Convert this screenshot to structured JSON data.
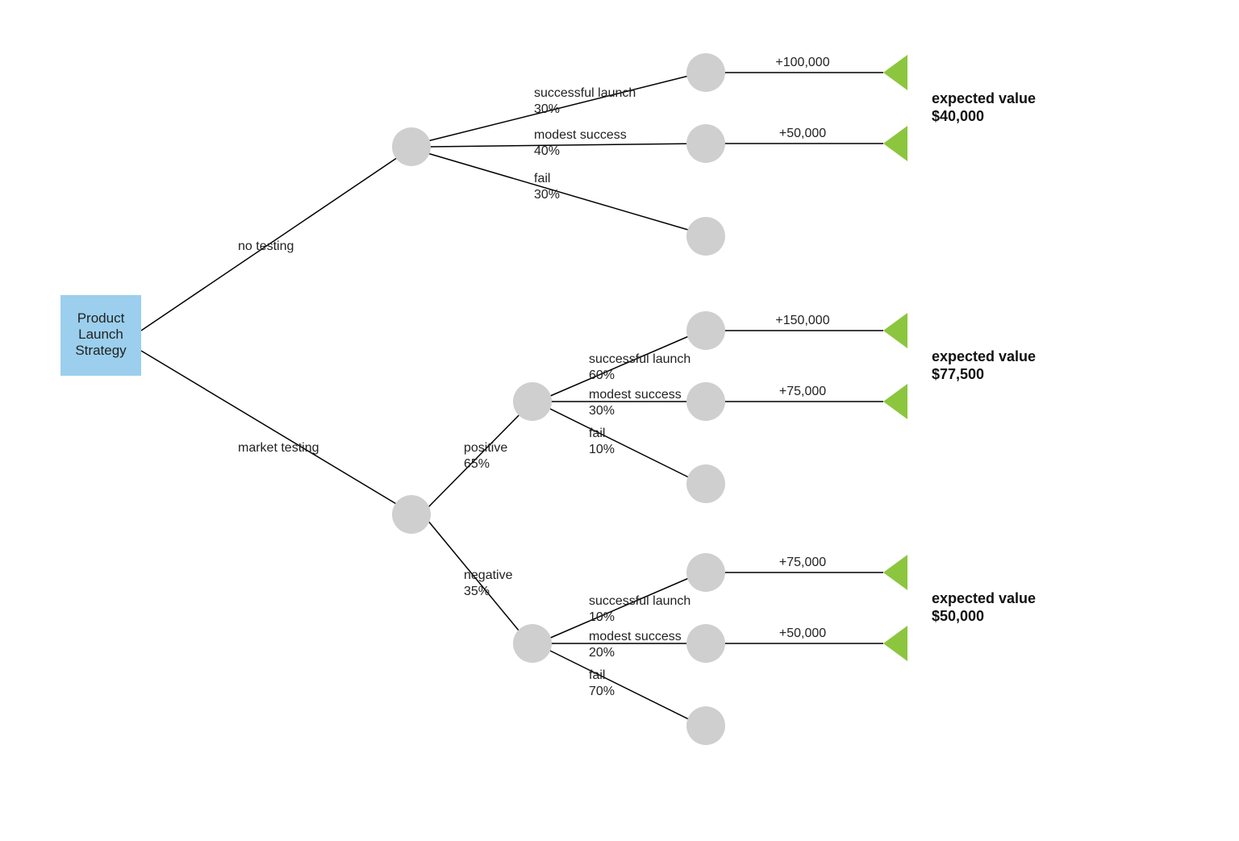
{
  "colors": {
    "root_fill": "#9BCFED",
    "chance_fill": "#CFCFCF",
    "terminal_fill": "#8CC63F"
  },
  "root": {
    "line1": "Product",
    "line2": "Launch",
    "line3": "Strategy"
  },
  "branches": {
    "no_testing": "no testing",
    "market_testing": "market testing",
    "positive": "positive",
    "positive_prob": "65%",
    "negative": "negative",
    "negative_prob": "35%"
  },
  "outcomes": {
    "successful_launch": "successful launch",
    "modest_success": "modest success",
    "fail": "fail"
  },
  "group1": {
    "successful_prob": "30%",
    "modest_prob": "40%",
    "fail_prob": "30%",
    "payoff_success": "+100,000",
    "payoff_modest": "+50,000",
    "ev_label": "expected value",
    "ev_value": "$40,000"
  },
  "group2": {
    "successful_prob": "60%",
    "modest_prob": "30%",
    "fail_prob": "10%",
    "payoff_success": "+150,000",
    "payoff_modest": "+75,000",
    "ev_label": "expected value",
    "ev_value": "$77,500"
  },
  "group3": {
    "successful_prob": "10%",
    "modest_prob": "20%",
    "fail_prob": "70%",
    "payoff_success": "+75,000",
    "payoff_modest": "+50,000",
    "ev_label": "expected value",
    "ev_value": "$50,000"
  },
  "chart_data": {
    "type": "decision-tree",
    "title": "Product Launch Strategy",
    "decision_node": "Product Launch Strategy",
    "alternatives": [
      {
        "name": "no testing",
        "type": "chance",
        "outcomes": [
          {
            "name": "successful launch",
            "probability": 0.3,
            "payoff": 100000
          },
          {
            "name": "modest success",
            "probability": 0.4,
            "payoff": 50000
          },
          {
            "name": "fail",
            "probability": 0.3,
            "payoff": null
          }
        ],
        "expected_value": 40000
      },
      {
        "name": "market testing",
        "type": "chance",
        "outcomes": [
          {
            "name": "positive",
            "probability": 0.65,
            "type": "chance",
            "outcomes": [
              {
                "name": "successful launch",
                "probability": 0.6,
                "payoff": 150000
              },
              {
                "name": "modest success",
                "probability": 0.3,
                "payoff": 75000
              },
              {
                "name": "fail",
                "probability": 0.1,
                "payoff": null
              }
            ],
            "expected_value": 77500
          },
          {
            "name": "negative",
            "probability": 0.35,
            "type": "chance",
            "outcomes": [
              {
                "name": "successful launch",
                "probability": 0.1,
                "payoff": 75000
              },
              {
                "name": "modest success",
                "probability": 0.2,
                "payoff": 50000
              },
              {
                "name": "fail",
                "probability": 0.7,
                "payoff": null
              }
            ],
            "expected_value": 50000
          }
        ]
      }
    ]
  }
}
